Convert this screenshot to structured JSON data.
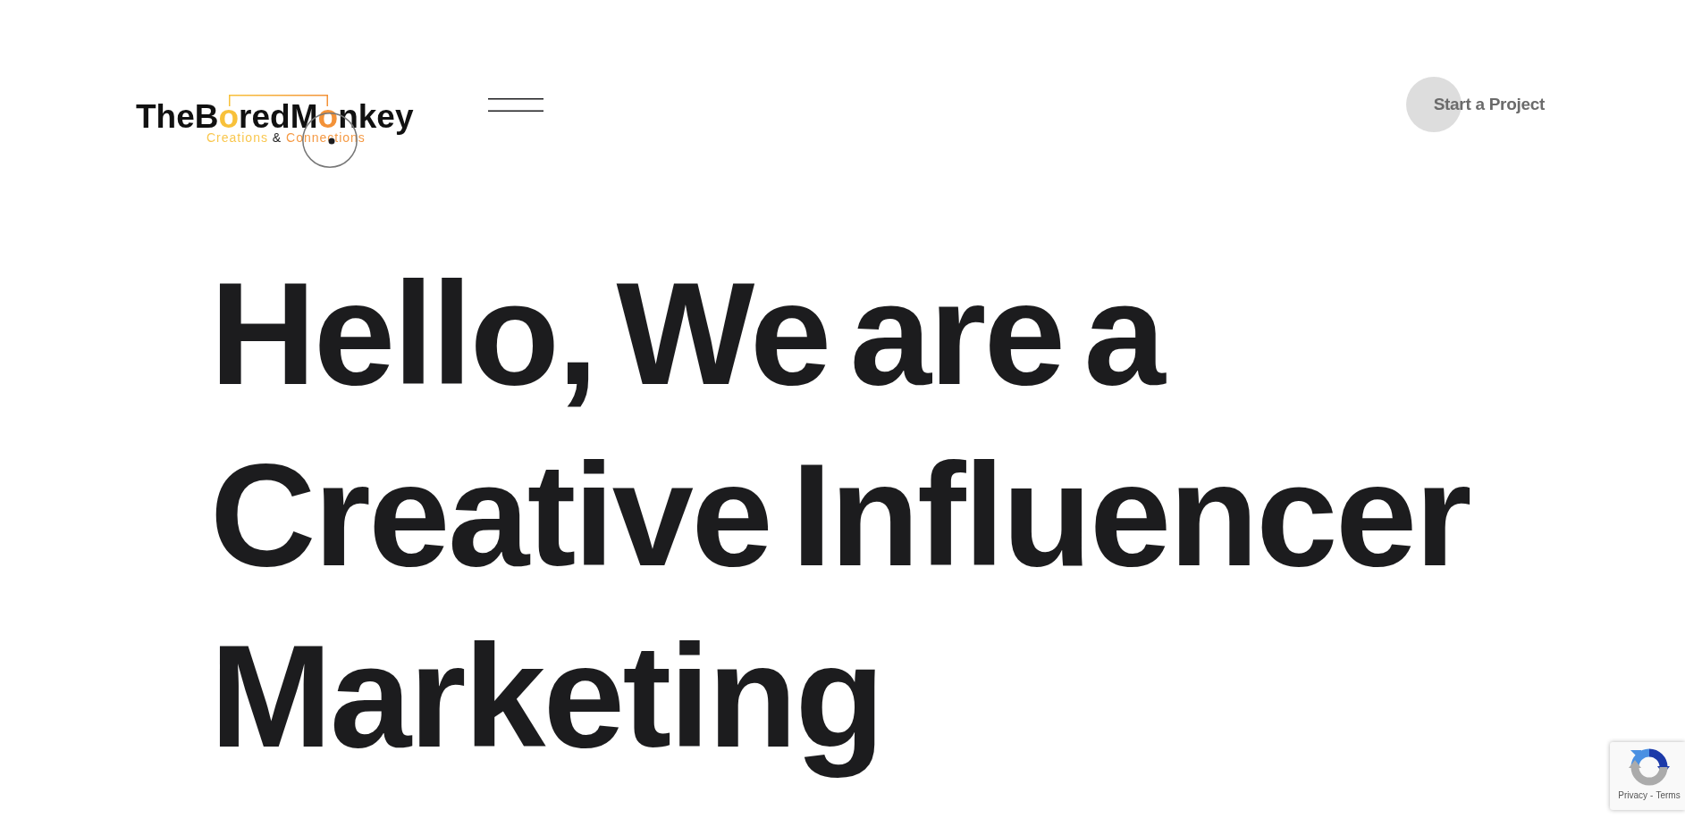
{
  "header": {
    "logo": {
      "wordmark": [
        {
          "text": "TheB",
          "color": "#111111"
        },
        {
          "text": "o",
          "color": "#f8c13a"
        },
        {
          "text": "redM",
          "color": "#111111"
        },
        {
          "text": "o",
          "color": "#f39238"
        },
        {
          "text": "nkey",
          "color": "#111111"
        }
      ],
      "tagline": [
        {
          "text": "Creations",
          "color": "#f9c74f"
        },
        {
          "text": "&",
          "color": "#222222"
        },
        {
          "text": "Connections",
          "color": "#f59a45"
        }
      ]
    },
    "cta": {
      "label": "Start a Project"
    }
  },
  "hero": {
    "heading_lines": [
      "Hello, We are a",
      "Creative Influencer",
      "Marketing"
    ]
  },
  "captcha_badge": {
    "links": [
      "Privacy",
      "Terms"
    ],
    "separator": "-"
  }
}
